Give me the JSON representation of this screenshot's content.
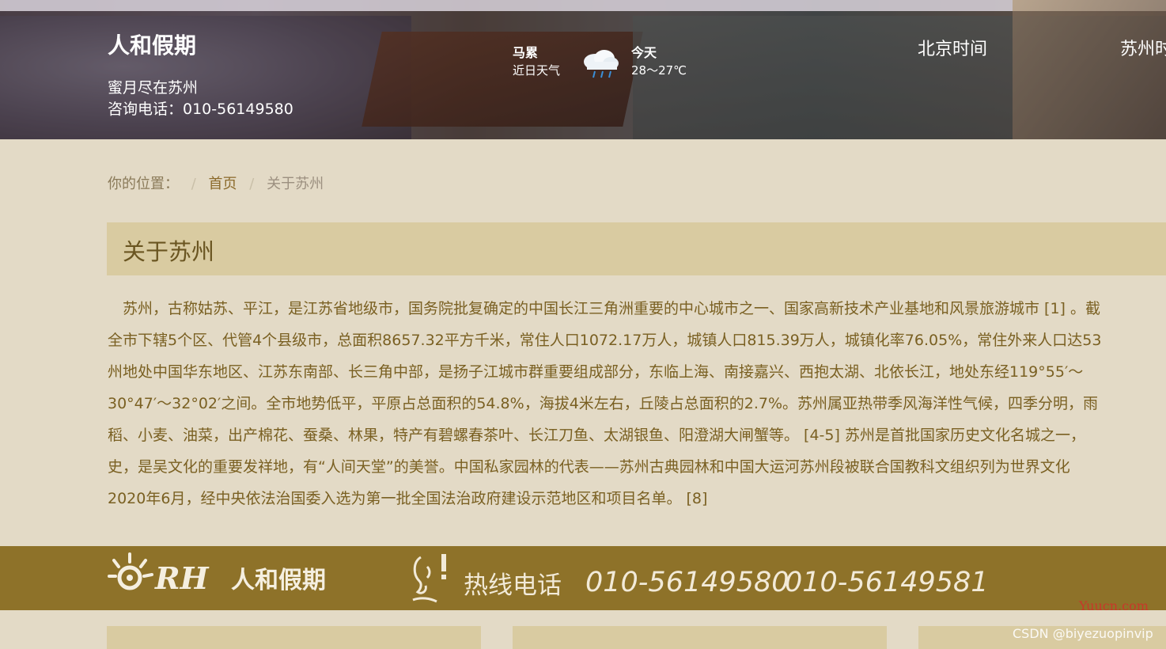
{
  "header": {
    "site_title": "人和假期",
    "tagline": "蜜月尽在苏州",
    "phone": "咨询电话：010-56149580",
    "weather": {
      "city": "马累",
      "subtitle": "近日天气",
      "day": "今天",
      "temperature": "28～27℃",
      "icon": "cloud-rain-icon"
    },
    "time_beijing": "北京时间",
    "time_suzhou": "苏州时"
  },
  "breadcrumb": {
    "label": "你的位置：",
    "separator": "/",
    "home": "首页",
    "current": "关于苏州"
  },
  "section": {
    "title": "关于苏州"
  },
  "article": {
    "lines": [
      "　苏州，古称姑苏、平江，是江苏省地级市，国务院批复确定的中国长江三角洲重要的中心城市之一、国家高新技术产业基地和风景旅游城市 [1] 。截",
      "全市下辖5个区、代管4个县级市，总面积8657.32平方千米，常住人口1072.17万人，城镇人口815.39万人，城镇化率76.05%，常住外来人口达53",
      "州地处中国华东地区、江苏东南部、长三角中部，是扬子江城市群重要组成部分，东临上海、南接嘉兴、西抱太湖、北依长江，地处东经119°55′～",
      "30°47′～32°02′之间。全市地势低平，平原占总面积的54.8%，海拔4米左右，丘陵占总面积的2.7%。苏州属亚热带季风海洋性气候，四季分明，雨",
      "稻、小麦、油菜，出产棉花、蚕桑、林果，特产有碧螺春茶叶、长江刀鱼、太湖银鱼、阳澄湖大闸蟹等。 [4-5] 苏州是首批国家历史文化名城之一，",
      "史，是吴文化的重要发祥地，有“人间天堂”的美誉。中国私家园林的代表——苏州古典园林和中国大运河苏州段被联合国教科文组织列为世界文化",
      "2020年6月，经中央依法治国委入选为第一批全国法治政府建设示范地区和项目名单。 [8]"
    ]
  },
  "footer": {
    "brand_rh": "RH",
    "brand_name": "人和假期",
    "hotline_label": "热线电话",
    "hotline_1": "010-56149580",
    "hotline_2": "010-56149581"
  },
  "watermarks": {
    "site": "Yuucn.com",
    "csdn": "CSDN @biyezuopinvip"
  },
  "colors": {
    "background": "#e3dac6",
    "section_head": "#d9cba1",
    "text": "#7a6022",
    "footer": "#8e7229"
  }
}
